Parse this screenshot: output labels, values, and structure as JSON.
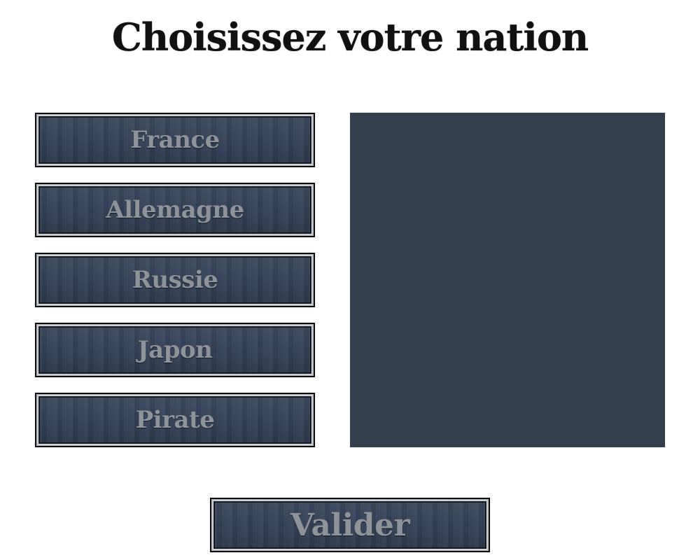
{
  "title": "Choisissez votre nation",
  "nations": {
    "france": "France",
    "allemagne": "Allemagne",
    "russie": "Russie",
    "japon": "Japon",
    "pirate": "Pirate"
  },
  "validate_label": "Valider",
  "colors": {
    "button_base": "#34425a",
    "button_text": "#8e9299",
    "preview_panel": "#333e4f",
    "title_text": "#111111",
    "background": "#ffffff"
  }
}
